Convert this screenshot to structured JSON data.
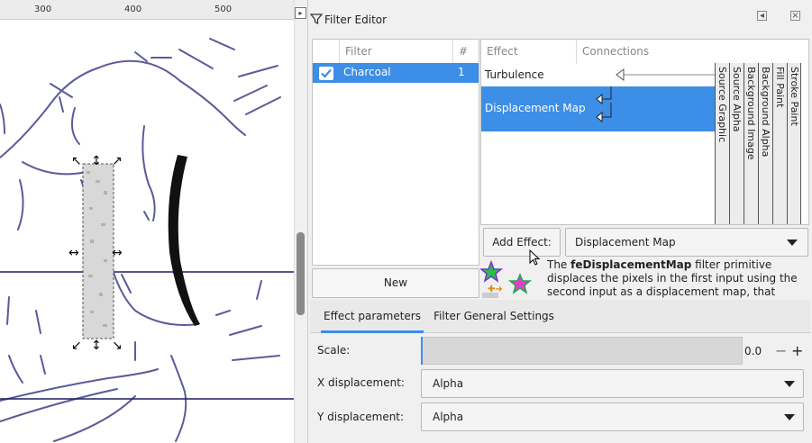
{
  "ruler": {
    "ticks": [
      "300",
      "400",
      "500"
    ]
  },
  "panel": {
    "title": "Filter Editor"
  },
  "filter_table": {
    "headers": {
      "filter": "Filter",
      "count": "#"
    },
    "rows": [
      {
        "name": "Charcoal",
        "count": "1",
        "checked": true
      }
    ]
  },
  "new_button": "New",
  "effect_table": {
    "headers": {
      "effect": "Effect",
      "connections": "Connections"
    },
    "rows": [
      {
        "name": "Turbulence",
        "selected": false
      },
      {
        "name": "Displacement Map",
        "selected": true
      }
    ],
    "inputs": [
      "Source Graphic",
      "Source Alpha",
      "Background Image",
      "Background Alpha",
      "Fill Paint",
      "Stroke Paint"
    ]
  },
  "add_effect": {
    "button": "Add Effect:",
    "selected": "Displacement Map"
  },
  "description": {
    "lead": "The ",
    "bold": "feDisplacementMap",
    "rest": " filter primitive displaces the pixels in the first input using the second input as a displacement map, that shows from how far the pixel"
  },
  "tabs": {
    "params": "Effect parameters",
    "general": "Filter General Settings"
  },
  "params": {
    "scale_label": "Scale:",
    "scale_value": "0.0",
    "x_label": "X displacement:",
    "x_value": "Alpha",
    "y_label": "Y displacement:",
    "y_value": "Alpha",
    "minus": "−",
    "plus": "+"
  },
  "colors": {
    "accent": "#3d8ee6",
    "stroke": "#5b5b9a"
  }
}
